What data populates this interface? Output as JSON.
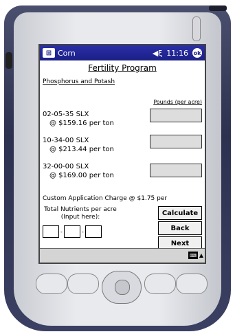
{
  "statusbar": {
    "app_title": "Corn",
    "volume_icon": "speaker-icon",
    "time": "11:16",
    "ok_label": "ok"
  },
  "page": {
    "heading": "Fertility Program",
    "section_label": "Phosphorus and Potash",
    "pounds_label": "Pounds (per acre)"
  },
  "items": [
    {
      "name": "02-05-35 SLX",
      "price": "@ $159.16 per ton"
    },
    {
      "name": "10-34-00 SLX",
      "price": "@ $213.44 per ton"
    },
    {
      "name": "32-00-00 SLX",
      "price": "@ $169.00 per ton"
    }
  ],
  "custom_charge": "Custom Application Charge @ $1.75 per",
  "total_label": "Total Nutrients per acre (Input here):",
  "nutrient_separators": [
    "-",
    "-"
  ],
  "buttons": {
    "calculate": "Calculate",
    "back": "Back",
    "next": "Next"
  },
  "taskbar": {
    "keyboard_icon": "keyboard-icon",
    "arrow": "▲"
  },
  "colors": {
    "titlebar": "#1b1f86",
    "device": "#2d3150",
    "screen_bg": "#ffffff",
    "input_bg": "#dddddd"
  }
}
